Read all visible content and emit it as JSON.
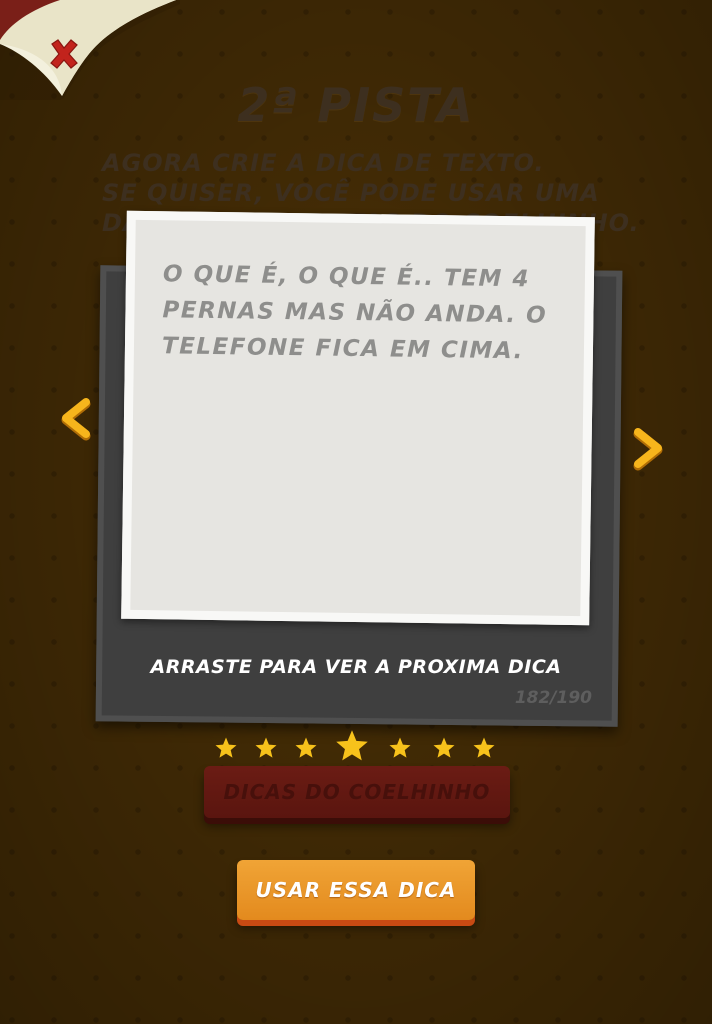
{
  "header": {
    "title": "2ª PISTA",
    "subtitle": "AGORA CRIE A DICA DE TEXTO.\nSE QUISER, VOCÊ PODE USAR UMA\nDAS DICAS PRONTAS DO COELHINHO."
  },
  "hint_card": {
    "text": "O QUE É, O QUE É.. TEM 4\nPERNAS MAS NÃO ANDA. O\nTELEFONE FICA EM CIMA.",
    "swipe_hint": "ARRASTE  PARA VER A PROXIMA DICA",
    "counter": "182/190"
  },
  "stars": {
    "count": 7,
    "highlighted_index": 3,
    "color": "#f7c21b"
  },
  "buttons": {
    "tips_label": "DICAS DO COELHINHO",
    "use_label": "USAR ESSA DICA"
  },
  "icons": {
    "close": "close-icon",
    "previous": "chevron-left-icon",
    "next": "chevron-right-icon"
  },
  "colors": {
    "background": "#4a3006",
    "accent_orange": "#e38a1e",
    "close_red": "#c2231c",
    "arrow_yellow": "#f7b51c"
  }
}
